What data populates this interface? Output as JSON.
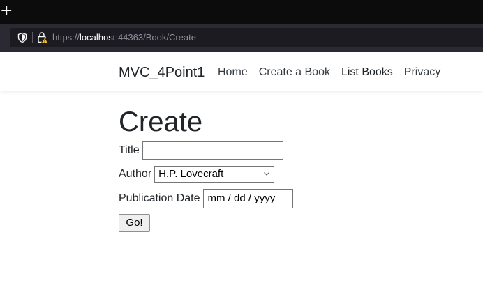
{
  "browser": {
    "new_tab_glyph": "+",
    "url_prefix": "https://",
    "url_host": "localhost",
    "url_rest": ":44363/Book/Create"
  },
  "navbar": {
    "brand": "MVC_4Point1",
    "links": [
      "Home",
      "Create a Book",
      "List Books",
      "Privacy"
    ]
  },
  "form": {
    "heading": "Create",
    "title_label": "Title",
    "title_value": "",
    "author_label": "Author",
    "author_selected": "H.P. Lovecraft",
    "date_label": "Publication Date",
    "date_placeholder": "mm / dd / yyyy",
    "submit_label": "Go!"
  }
}
